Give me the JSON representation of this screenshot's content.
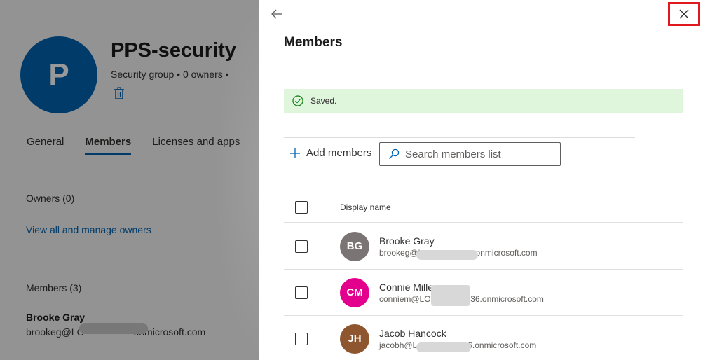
{
  "background": {
    "group": {
      "avatar_initial": "P",
      "title": "PPS-security",
      "meta": "Security group  • 0 owners  •"
    },
    "tabs": [
      {
        "label": "General",
        "active": false
      },
      {
        "label": "Members",
        "active": true
      },
      {
        "label": "Licenses and apps",
        "active": false
      }
    ],
    "owners_heading": "Owners (0)",
    "manage_owners_link": "View all and manage owners",
    "members_heading": "Members (3)",
    "first_member": {
      "name": "Brooke Gray",
      "email": "brookeg@LO     onmicrosoft.com"
    }
  },
  "panel": {
    "title": "Members",
    "saved_message": "Saved.",
    "add_members_label": "Add members",
    "search_placeholder": "Search members list",
    "column_display_name": "Display name",
    "members": [
      {
        "initials": "BG",
        "name": "Brooke Gray",
        "email": "brookeg@L      .onmicrosoft.com",
        "avatar_color": "#7a7574"
      },
      {
        "initials": "CM",
        "name": "Connie Miller",
        "email": "conniem@LOD    36.onmicrosoft.com",
        "avatar_color": "#e3008c"
      },
      {
        "initials": "JH",
        "name": "Jacob Hancock",
        "email": "jacobh@L      6.onmicrosoft.com",
        "avatar_color": "#8e562e"
      }
    ]
  },
  "colors": {
    "accent": "#0063b1",
    "success_bg": "#dff6dd",
    "success_icon": "#107c10",
    "close_highlight": "#e0191f"
  },
  "icons": {
    "back": "arrow-left-icon",
    "close": "close-icon",
    "saved": "check-circle-icon",
    "add": "plus-icon",
    "search": "search-icon",
    "delete": "trash-icon"
  }
}
